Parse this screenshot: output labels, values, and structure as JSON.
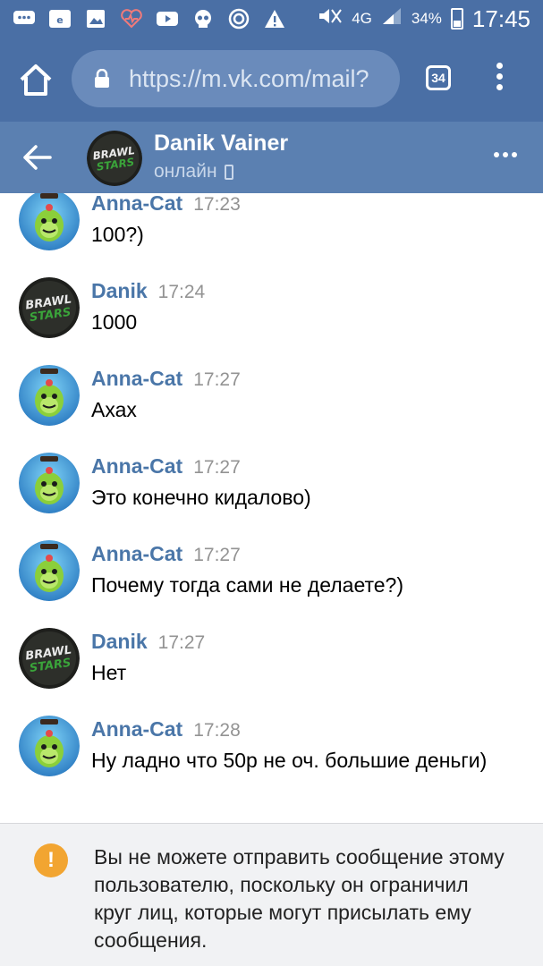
{
  "status_bar": {
    "network": "4G",
    "battery": "34%",
    "time": "17:45",
    "icons": [
      "chat-icon",
      "cloud-icon",
      "gallery-icon",
      "health-icon",
      "youtube-icon",
      "skull-icon",
      "vpn-icon",
      "warning-icon",
      "mute-icon",
      "signal-icon",
      "battery-icon"
    ]
  },
  "browser": {
    "url": "https://m.vk.com/mail?",
    "tabs_count": "34"
  },
  "header": {
    "name": "Danik Vainer",
    "status": "онлайн"
  },
  "messages": [
    {
      "author": "Anna-Cat",
      "time": "17:23",
      "text": "100?)",
      "avatar": "spike-cactus"
    },
    {
      "author": "Danik",
      "time": "17:24",
      "text": "1000",
      "avatar": "brawl-stars-logo"
    },
    {
      "author": "Anna-Cat",
      "time": "17:27",
      "text": "Ахах",
      "avatar": "spike-cactus"
    },
    {
      "author": "Anna-Cat",
      "time": "17:27",
      "text": "Это конечно кидалово)",
      "avatar": "spike-cactus"
    },
    {
      "author": "Anna-Cat",
      "time": "17:27",
      "text": "Почему тогда сами не делаете?)",
      "avatar": "spike-cactus"
    },
    {
      "author": "Danik",
      "time": "17:27",
      "text": "Нет",
      "avatar": "brawl-stars-logo"
    },
    {
      "author": "Anna-Cat",
      "time": "17:28",
      "text": "Ну ладно что 50р не оч. большие деньги)",
      "avatar": "spike-cactus"
    }
  ],
  "notice": {
    "icon": "!",
    "text": "Вы не можете отправить сообщение этому пользователю, поскольку он ограничил круг лиц, которые могут присылать ему сообщения."
  },
  "colors": {
    "browser_bar": "#4a6fa5",
    "header": "#5b80b1",
    "author": "#4a76a8",
    "warning": "#f2a531"
  }
}
